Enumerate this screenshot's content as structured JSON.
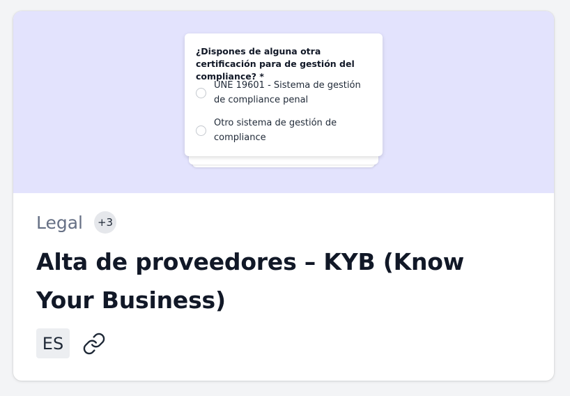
{
  "preview": {
    "question": "¿Dispones de alguna otra certificación para de gestión del compliance? *",
    "options": [
      {
        "label": "UNE 19601 - Sistema de gestión de compliance penal"
      },
      {
        "label": "Otro sistema de gestión de compliance"
      }
    ],
    "background_color": "#e3e3fd"
  },
  "template": {
    "category": "Legal",
    "extra_categories": "+3",
    "title": "Alta de proveedores – KYB (Know Your Business)",
    "language": "ES",
    "link_icon": "link-icon"
  }
}
